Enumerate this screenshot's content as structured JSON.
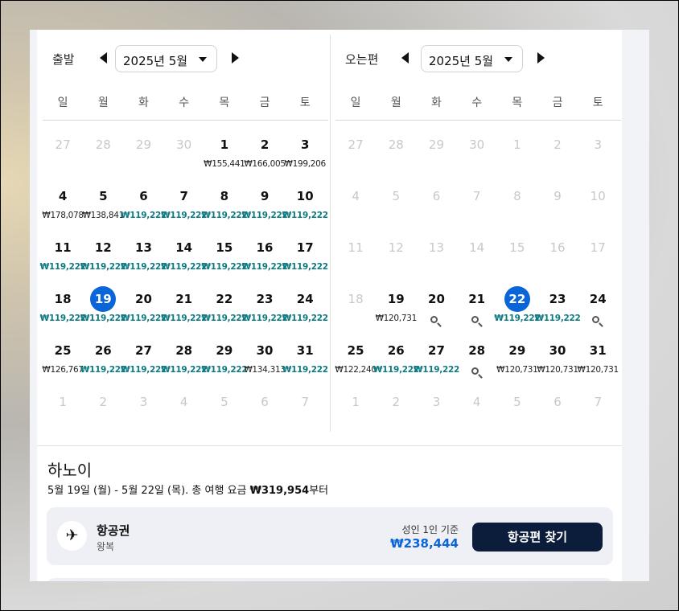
{
  "weekdays": [
    "일",
    "월",
    "화",
    "수",
    "목",
    "금",
    "토"
  ],
  "departure": {
    "label": "출발",
    "month_label": "2025년 5월",
    "days": [
      {
        "d": "27",
        "muted": true
      },
      {
        "d": "28",
        "muted": true
      },
      {
        "d": "29",
        "muted": true
      },
      {
        "d": "30",
        "muted": true
      },
      {
        "d": "1",
        "price": "₩155,441"
      },
      {
        "d": "2",
        "price": "₩166,005"
      },
      {
        "d": "3",
        "price": "₩199,206"
      },
      {
        "d": "4",
        "price": "₩178,078"
      },
      {
        "d": "5",
        "price": "₩138,841"
      },
      {
        "d": "6",
        "price": "₩119,222",
        "cheap": true
      },
      {
        "d": "7",
        "price": "₩119,222",
        "cheap": true
      },
      {
        "d": "8",
        "price": "₩119,222",
        "cheap": true
      },
      {
        "d": "9",
        "price": "₩119,222",
        "cheap": true
      },
      {
        "d": "10",
        "price": "₩119,222",
        "cheap": true
      },
      {
        "d": "11",
        "price": "₩119,222",
        "cheap": true
      },
      {
        "d": "12",
        "price": "₩119,222",
        "cheap": true
      },
      {
        "d": "13",
        "price": "₩119,222",
        "cheap": true
      },
      {
        "d": "14",
        "price": "₩119,222",
        "cheap": true
      },
      {
        "d": "15",
        "price": "₩119,222",
        "cheap": true
      },
      {
        "d": "16",
        "price": "₩119,222",
        "cheap": true
      },
      {
        "d": "17",
        "price": "₩119,222",
        "cheap": true
      },
      {
        "d": "18",
        "price": "₩119,222",
        "cheap": true
      },
      {
        "d": "19",
        "price": "₩119,222",
        "cheap": true,
        "selected": true
      },
      {
        "d": "20",
        "price": "₩119,222",
        "cheap": true
      },
      {
        "d": "21",
        "price": "₩119,222",
        "cheap": true
      },
      {
        "d": "22",
        "price": "₩119,222",
        "cheap": true
      },
      {
        "d": "23",
        "price": "₩119,222",
        "cheap": true
      },
      {
        "d": "24",
        "price": "₩119,222",
        "cheap": true
      },
      {
        "d": "25",
        "price": "₩126,767"
      },
      {
        "d": "26",
        "price": "₩119,222",
        "cheap": true
      },
      {
        "d": "27",
        "price": "₩119,222",
        "cheap": true
      },
      {
        "d": "28",
        "price": "₩119,222",
        "cheap": true
      },
      {
        "d": "29",
        "price": "₩119,222",
        "cheap": true
      },
      {
        "d": "30",
        "price": "₩134,313"
      },
      {
        "d": "31",
        "price": "₩119,222",
        "cheap": true
      },
      {
        "d": "1",
        "muted": true
      },
      {
        "d": "2",
        "muted": true
      },
      {
        "d": "3",
        "muted": true
      },
      {
        "d": "4",
        "muted": true
      },
      {
        "d": "5",
        "muted": true
      },
      {
        "d": "6",
        "muted": true
      },
      {
        "d": "7",
        "muted": true
      }
    ]
  },
  "return": {
    "label": "오는편",
    "month_label": "2025년 5월",
    "days": [
      {
        "d": "27",
        "muted": true
      },
      {
        "d": "28",
        "muted": true
      },
      {
        "d": "29",
        "muted": true
      },
      {
        "d": "30",
        "muted": true
      },
      {
        "d": "1",
        "muted": true
      },
      {
        "d": "2",
        "muted": true
      },
      {
        "d": "3",
        "muted": true
      },
      {
        "d": "4",
        "muted": true
      },
      {
        "d": "5",
        "muted": true
      },
      {
        "d": "6",
        "muted": true
      },
      {
        "d": "7",
        "muted": true
      },
      {
        "d": "8",
        "muted": true
      },
      {
        "d": "9",
        "muted": true
      },
      {
        "d": "10",
        "muted": true
      },
      {
        "d": "11",
        "muted": true
      },
      {
        "d": "12",
        "muted": true
      },
      {
        "d": "13",
        "muted": true
      },
      {
        "d": "14",
        "muted": true
      },
      {
        "d": "15",
        "muted": true
      },
      {
        "d": "16",
        "muted": true
      },
      {
        "d": "17",
        "muted": true
      },
      {
        "d": "18",
        "muted": true
      },
      {
        "d": "19",
        "price": "₩120,731"
      },
      {
        "d": "20",
        "search": true
      },
      {
        "d": "21",
        "search": true
      },
      {
        "d": "22",
        "price": "₩119,222",
        "cheap": true,
        "selected": true
      },
      {
        "d": "23",
        "price": "₩119,222",
        "cheap": true
      },
      {
        "d": "24",
        "search": true
      },
      {
        "d": "25",
        "price": "₩122,240"
      },
      {
        "d": "26",
        "price": "₩119,222",
        "cheap": true
      },
      {
        "d": "27",
        "price": "₩119,222",
        "cheap": true
      },
      {
        "d": "28",
        "search": true
      },
      {
        "d": "29",
        "price": "₩120,731"
      },
      {
        "d": "30",
        "price": "₩120,731"
      },
      {
        "d": "31",
        "price": "₩120,731"
      },
      {
        "d": "1",
        "muted": true
      },
      {
        "d": "2",
        "muted": true
      },
      {
        "d": "3",
        "muted": true
      },
      {
        "d": "4",
        "muted": true
      },
      {
        "d": "5",
        "muted": true
      },
      {
        "d": "6",
        "muted": true
      },
      {
        "d": "7",
        "muted": true
      }
    ]
  },
  "summary": {
    "destination": "하노이",
    "dates_text": "5월 19일 (월) - 5월 22일 (목). 총 여행 요금 ",
    "total": "₩319,954",
    "suffix": "부터"
  },
  "flight": {
    "icon": "airplane-icon",
    "title": "항공권",
    "subtitle": "왕복",
    "basis": "성인 1인 기준",
    "price": "₩238,444",
    "button": "항공편 찾기"
  },
  "colors": {
    "selected": "#0a66d8",
    "cheap_price": "#0e7a82",
    "cta_bg": "#0b1d3a"
  }
}
